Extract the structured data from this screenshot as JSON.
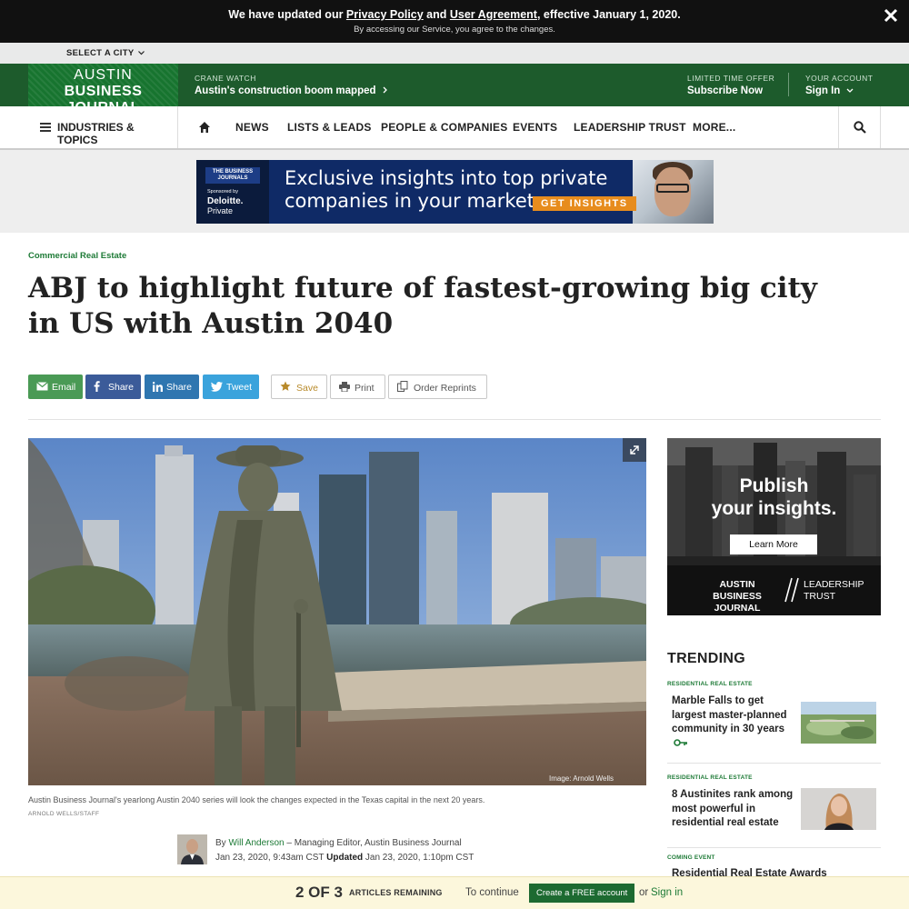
{
  "notice": {
    "prefix": "We have updated our ",
    "privacy_link": "Privacy Policy",
    "mid": " and ",
    "agreement_link": "User Agreement",
    "suffix": ", effective January 1, 2020.",
    "line2": "By accessing our Service, you agree to the changes."
  },
  "city_bar": {
    "label": "SELECT A CITY"
  },
  "header": {
    "logo_line1": "AUSTIN",
    "logo_line2": "BUSINESS JOURNAL",
    "crane_kicker": "CRANE WATCH",
    "crane_title": "Austin's construction boom mapped",
    "offer_kicker": "LIMITED TIME OFFER",
    "offer_title": "Subscribe Now",
    "account_kicker": "YOUR ACCOUNT",
    "account_title": "Sign In"
  },
  "nav": {
    "industries": "INDUSTRIES & TOPICS",
    "items": [
      "NEWS",
      "LISTS & LEADS",
      "PEOPLE & COMPANIES",
      "EVENTS",
      "LEADERSHIP TRUST",
      "MORE..."
    ]
  },
  "top_ad": {
    "brand": "THE BUSINESS JOURNALS",
    "sponsored": "Sponsored by",
    "sponsor": "Deloitte.",
    "sponsor_sub": "Private",
    "headline_line1": "Exclusive insights into top private",
    "headline_line2": "companies in your market.",
    "cta": "GET INSIGHTS"
  },
  "article": {
    "category": "Commercial Real Estate",
    "headline": "ABJ to highlight future of fastest-growing big city in US with Austin 2040",
    "share": {
      "email": "Email",
      "facebook": "Share",
      "linkedin": "Share",
      "twitter": "Tweet",
      "save": "Save",
      "print": "Print",
      "reprints": "Order Reprints"
    },
    "photo_credit_overlay": "Image: Arnold Wells",
    "caption": "Austin Business Journal's yearlong Austin 2040 series will look the changes expected in the Texas capital in the next 20 years.",
    "credit": "ARNOLD WELLS/STAFF",
    "byline": {
      "by": "By ",
      "author": "Will Anderson",
      "role": " – Managing Editor, Austin Business Journal",
      "date": "Jan 23, 2020, 9:43am CST ",
      "updated_label": "Updated",
      "updated_date": " Jan 23, 2020, 1:10pm CST"
    }
  },
  "sidebar_ad": {
    "line1": "Publish",
    "line2": "your insights.",
    "button": "Learn More",
    "foot_left_1": "AUSTIN",
    "foot_left_2": "BUSINESS JOURNAL",
    "foot_right_1": "LEADERSHIP",
    "foot_right_2": "TRUST"
  },
  "trending": {
    "title": "TRENDING",
    "items": [
      {
        "kicker": "RESIDENTIAL REAL ESTATE",
        "title": "Marble Falls to get largest master-planned community in 30 years"
      },
      {
        "kicker": "RESIDENTIAL REAL ESTATE",
        "title": "8 Austinites rank among most powerful in residential real estate"
      },
      {
        "kicker": "COMING EVENT",
        "title": "Residential Real Estate Awards"
      }
    ]
  },
  "paywall": {
    "count": "2 OF 3",
    "label": "ARTICLES REMAINING",
    "continue": "To continue",
    "button": "Create a FREE account",
    "or": "or",
    "signin": "Sign in"
  },
  "colors": {
    "brand_green": "#1d5b2c",
    "link_green": "#1d7a36",
    "email": "#4a9a55",
    "facebook": "#3b5b99",
    "linkedin": "#2f76b0",
    "twitter": "#3aa3dc"
  }
}
